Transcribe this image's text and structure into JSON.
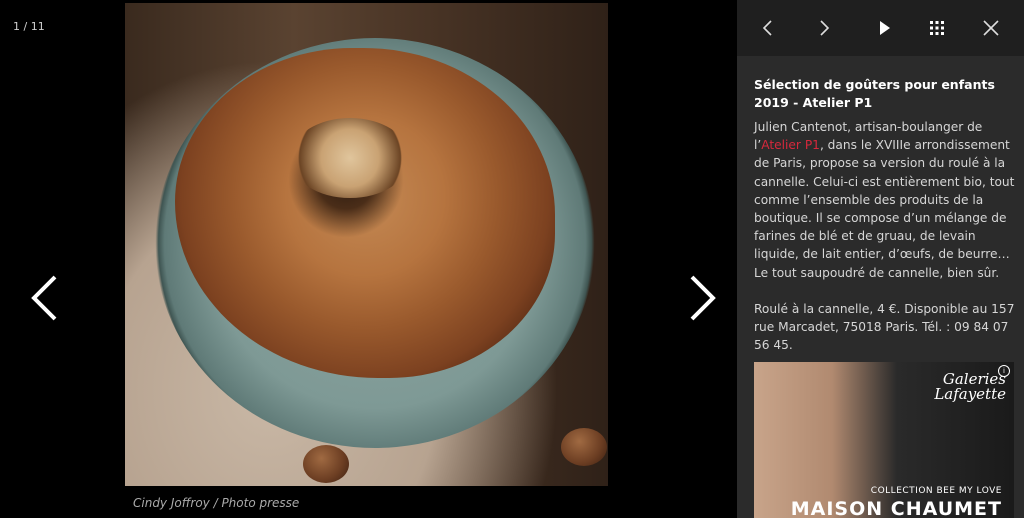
{
  "viewer": {
    "counter": "1 / 11",
    "caption": "Cindy Joffroy / Photo presse"
  },
  "panel": {
    "title": "Sélection de goûters pour enfants 2019 - Atelier P1",
    "para1": {
      "before": "Julien Cantenot, artisan-boulanger de l’",
      "link": "Atelier P1",
      "after": ", dans le XVIIIe arrondissement de Paris, propose sa version du roulé à la cannelle. Celui-ci est entièrement bio, tout comme l’ensemble des produits de la boutique. Il se compose d’un mélange de farines de blé et de gruau, de levain liquide, de lait entier, d’œufs, de beurre… Le tout saupoudré de cannelle, bien sûr."
    },
    "para2": "Roulé à la cannelle, 4 €. Disponible au 157 rue Marcadet, 75018 Paris. Tél. : 09 84 07 56 45."
  },
  "ad": {
    "brand_line1": "Galeries",
    "brand_line2": "Lafayette",
    "info": "i",
    "subtitle": "COLLECTION BEE MY LOVE",
    "headline": "MAISON CHAUMET"
  },
  "icons": {
    "toolbar": [
      "chevron-left-icon",
      "chevron-right-icon",
      "play-icon",
      "grid-icon",
      "close-icon"
    ],
    "viewer": [
      "chevron-left-icon",
      "chevron-right-icon"
    ]
  },
  "colors": {
    "accent_link": "#d6283c",
    "panel_bg": "#2b2b2b",
    "toolbar_bg": "#1f1f1f"
  }
}
